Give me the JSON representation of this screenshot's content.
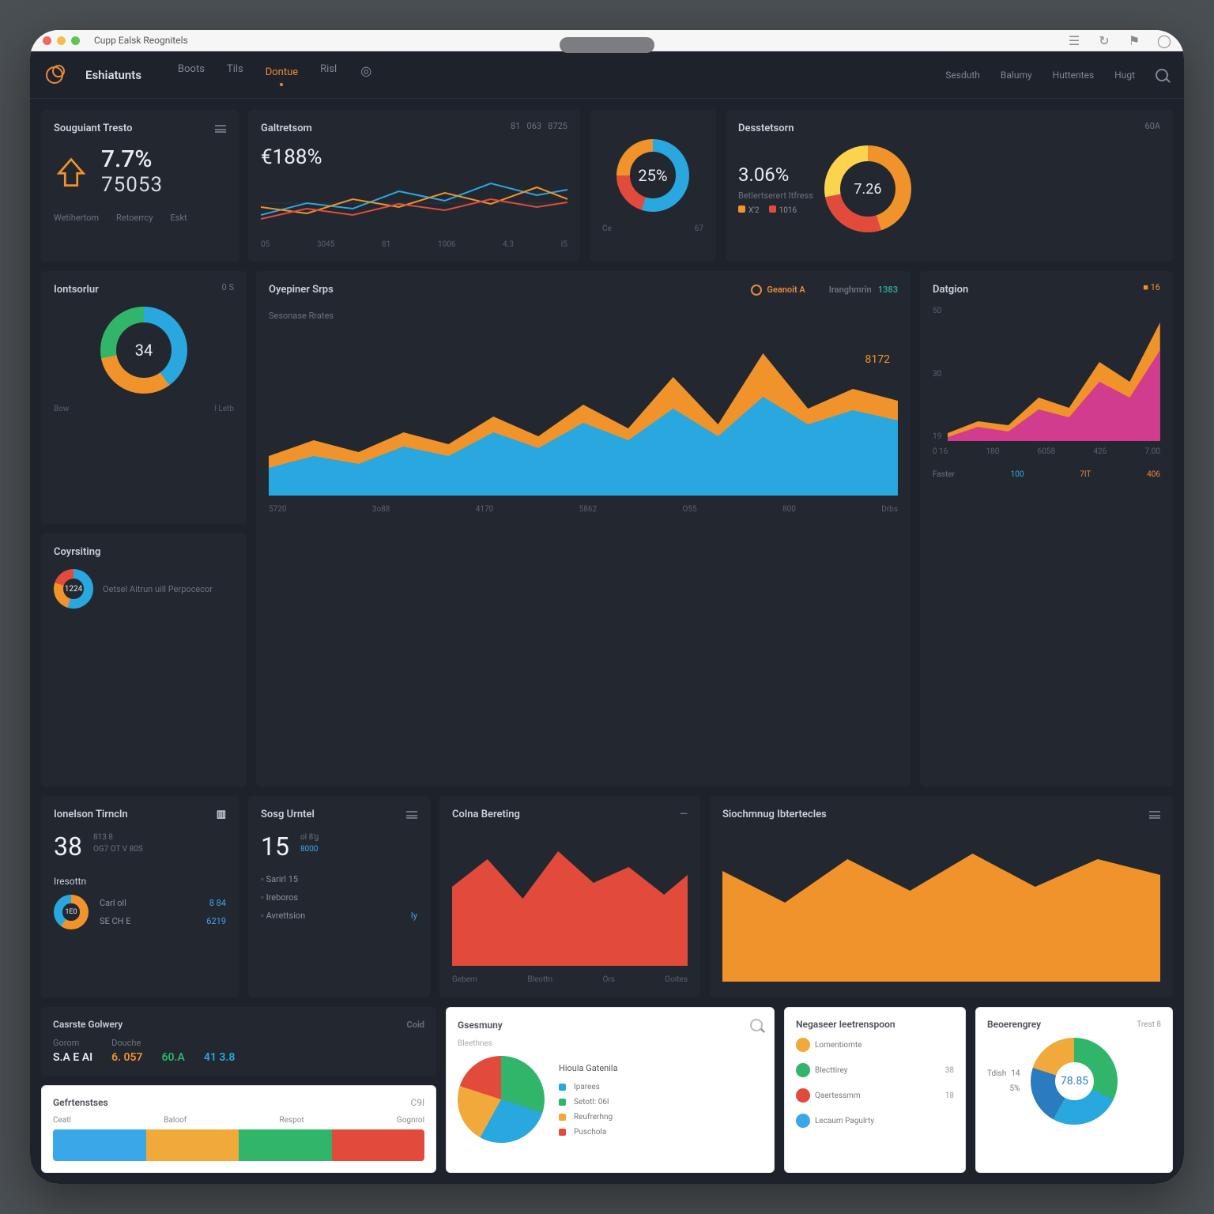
{
  "chrome": {
    "title": "Cupp Ealsk Reognitels"
  },
  "topnav": {
    "brand": "Eshiatunts",
    "links": [
      "Boots",
      "Tils",
      "Dontue",
      "Risl"
    ],
    "active_index": 2,
    "right": [
      "Sesduth",
      "Balumy",
      "Huttentes",
      "Hugt"
    ]
  },
  "row1": {
    "card_a": {
      "title": "Souguiant Tresto",
      "percent": "7.7%",
      "value": "75053",
      "tabs": [
        "Wetihertom",
        "Retoerrcy",
        "Eskt"
      ]
    },
    "card_b": {
      "title": "Galtretsom",
      "value": "€188%",
      "top_right": [
        "81",
        "063",
        "8725"
      ],
      "x": [
        "05",
        "3045",
        "81",
        "1006",
        "4.3",
        "I5"
      ]
    },
    "card_c": {
      "donut_value": "25%",
      "x": [
        "Ce",
        "67"
      ]
    },
    "card_d": {
      "title": "Desstetsorn",
      "hdr": "60A",
      "value": "3.06%",
      "donut_value": "7.26",
      "legend": [
        "X'2",
        "1016"
      ]
    }
  },
  "row2": {
    "side_a": {
      "title": "Iontsorlur",
      "hdr": "0 S",
      "donut_value": "34",
      "bottom": [
        "Bow",
        "I Letb"
      ]
    },
    "side_b": {
      "title": "Coyrsiting",
      "val": "1224",
      "desc": "Oetsel Aitrun uill Perpocecor"
    },
    "center": {
      "title": "Oyepiner Srps",
      "badge": "Geanoit A",
      "hdr_key": "Iranghmrin",
      "hdr_val": "1383",
      "sub": "Sesonase Rrates",
      "callout": "8172",
      "x": [
        "5720",
        "3o88",
        "4170",
        "5862",
        "O55",
        "800",
        "Drbs"
      ]
    },
    "right": {
      "title": "Datgion",
      "hdr": "16",
      "y": [
        "50",
        "30",
        "19"
      ],
      "x": [
        "0 16",
        "180",
        "6058",
        "426",
        "7.00"
      ],
      "foot": [
        {
          "k": "Faster",
          "v": "100",
          "c": "#3aa8e8"
        },
        {
          "k": "",
          "v": "7IT",
          "c": "#e98a3c"
        },
        {
          "k": "",
          "v": "406",
          "c": "#e98a3c"
        }
      ]
    }
  },
  "row3": {
    "a": {
      "title": "Ionelson Tirncln",
      "hdr_icon": "chart",
      "big": "38",
      "sub": "813 8\nOG7 OT V 80S",
      "sect": "Iresottn",
      "donut_val": "1E0",
      "rows": [
        {
          "k": "Carl oll",
          "v": "8 84"
        },
        {
          "k": "SE CH E",
          "v": "6219"
        }
      ]
    },
    "b": {
      "title": "Sosg Urntel",
      "big": "15",
      "sup": "ol 8'g",
      "val": "8000",
      "rows": [
        {
          "k": "Sarirl 15",
          "v": ""
        },
        {
          "k": "Ireboros",
          "v": ""
        },
        {
          "k": "Avrettsion",
          "v": "Iy"
        }
      ]
    },
    "c": {
      "title": "Colna Bereting",
      "x": [
        "Gebern",
        "Bleottn",
        "Ors",
        "Goites"
      ]
    },
    "d": {
      "title": "Siochmnug Ibtertecles"
    }
  },
  "bottom": {
    "dark": {
      "title": "Casrste Golwery",
      "hdr": "Coid",
      "cols": [
        {
          "k": "Gorom",
          "v": "S.A E AI",
          "c": "#e9edf2"
        },
        {
          "k": "Douche",
          "v": "6. 057",
          "c": "#e98a3c"
        },
        {
          "k": "",
          "v": "60.A",
          "c": "#31b56b"
        },
        {
          "k": "",
          "v": "41 3.8",
          "c": "#29a7df"
        }
      ]
    },
    "table": {
      "title": "Gefrtenstses",
      "hdr": "C9l",
      "cols": [
        "Ceatl",
        "Baloof",
        "Respot",
        "Gognrol"
      ],
      "colors": [
        "#3aa8e8",
        "#f0a93a",
        "#31b56b",
        "#e24b3b"
      ]
    },
    "pie1": {
      "title": "Gsesmuny",
      "sub": "Bleethnes",
      "sect": "Hioula Gatenila",
      "legend": [
        "Iparees",
        "Setotl: 06l",
        "Reufrerhng",
        "Puschola"
      ]
    },
    "list": {
      "title": "Negaseer Ieetrenspoon",
      "items": [
        {
          "label": "Lomentiomte",
          "v": "",
          "c": "#f0a93a"
        },
        {
          "label": "Blecttirey",
          "v": "38",
          "c": "#31b56b"
        },
        {
          "label": "Qaertessmm",
          "v": "18",
          "c": "#e24b3b"
        },
        {
          "label": "Lecaum Pagulrty",
          "v": "",
          "c": "#3aa8e8"
        }
      ]
    },
    "pie2": {
      "title": "Beoerengrey",
      "hdr": "Trest 8",
      "center": "78.85",
      "legend": [
        {
          "k": "Tdish",
          "v": "14"
        },
        {
          "k": "",
          "v": "5%"
        }
      ]
    }
  },
  "colors": {
    "blue": "#29a7df",
    "orange": "#f0932b",
    "green": "#31b56b",
    "red": "#e24b3b",
    "magenta": "#d13c8f",
    "teal": "#2aa89a"
  },
  "chart_data": [
    {
      "id": "row1_spark",
      "type": "line",
      "series": [
        {
          "name": "blue",
          "values": [
            20,
            35,
            28,
            50,
            38,
            60,
            45,
            52
          ]
        },
        {
          "name": "orange",
          "values": [
            30,
            22,
            40,
            30,
            48,
            34,
            55,
            40
          ]
        },
        {
          "name": "red",
          "values": [
            15,
            28,
            20,
            34,
            26,
            40,
            30,
            36
          ]
        }
      ],
      "x": [
        "05",
        "3045",
        "81",
        "1006",
        "4.3",
        "I5"
      ],
      "ylim": [
        0,
        70
      ]
    },
    {
      "id": "row1_donut1",
      "type": "pie",
      "values": [
        55,
        25,
        20
      ],
      "colors": [
        "#29a7df",
        "#e24b3b",
        "#f0932b"
      ],
      "center_label": "25%"
    },
    {
      "id": "row1_donut2",
      "type": "pie",
      "values": [
        45,
        30,
        25
      ],
      "colors": [
        "#f0932b",
        "#e24b3b",
        "#fbd34d"
      ],
      "center_label": "7.26"
    },
    {
      "id": "row2_side_donut",
      "type": "pie",
      "values": [
        40,
        35,
        25
      ],
      "colors": [
        "#29a7df",
        "#f0932b",
        "#31b56b"
      ],
      "center_label": "34"
    },
    {
      "id": "row2_center_area",
      "type": "area",
      "series": [
        {
          "name": "blue",
          "values": [
            60,
            80,
            55,
            95,
            70,
            120,
            90,
            140,
            100,
            125,
            110,
            150,
            105,
            135
          ]
        },
        {
          "name": "orange",
          "values": [
            80,
            70,
            95,
            75,
            110,
            85,
            135,
            95,
            160,
            110,
            260,
            140,
            175,
            150
          ]
        }
      ],
      "x": [
        "5720",
        "3o88",
        "4170",
        "5862",
        "O55",
        "800",
        "Drbs"
      ],
      "ylim": [
        0,
        280
      ]
    },
    {
      "id": "row2_right_area",
      "type": "area",
      "series": [
        {
          "name": "magenta",
          "values": [
            10,
            25,
            18,
            55,
            40,
            110,
            80,
            160
          ]
        },
        {
          "name": "orange",
          "values": [
            18,
            35,
            28,
            70,
            55,
            140,
            100,
            195
          ]
        }
      ],
      "x": [
        "0 16",
        "180",
        "6058",
        "426",
        "7.00"
      ],
      "y": [
        "19",
        "30",
        "50"
      ],
      "ylim": [
        0,
        200
      ]
    },
    {
      "id": "row3_red_area",
      "type": "area",
      "series": [
        {
          "name": "red",
          "values": [
            120,
            160,
            110,
            175,
            135,
            155,
            120,
            145
          ]
        }
      ],
      "x": [
        "Gebern",
        "Bleottn",
        "Ors",
        "Goites"
      ],
      "ylim": [
        0,
        200
      ]
    },
    {
      "id": "row3_orange_area",
      "type": "area",
      "series": [
        {
          "name": "orange",
          "values": [
            150,
            110,
            165,
            130,
            175,
            140,
            170,
            150
          ]
        }
      ],
      "ylim": [
        0,
        200
      ]
    },
    {
      "id": "bottom_pie1",
      "type": "pie",
      "values": [
        30,
        28,
        22,
        20
      ],
      "colors": [
        "#31b56b",
        "#29a7df",
        "#f0a93a",
        "#e24b3b"
      ]
    },
    {
      "id": "bottom_pie2",
      "type": "pie",
      "values": [
        32,
        26,
        22,
        20
      ],
      "colors": [
        "#31b56b",
        "#29a7df",
        "#2a7bbf",
        "#f0a93a"
      ],
      "center_label": "78.85"
    }
  ]
}
